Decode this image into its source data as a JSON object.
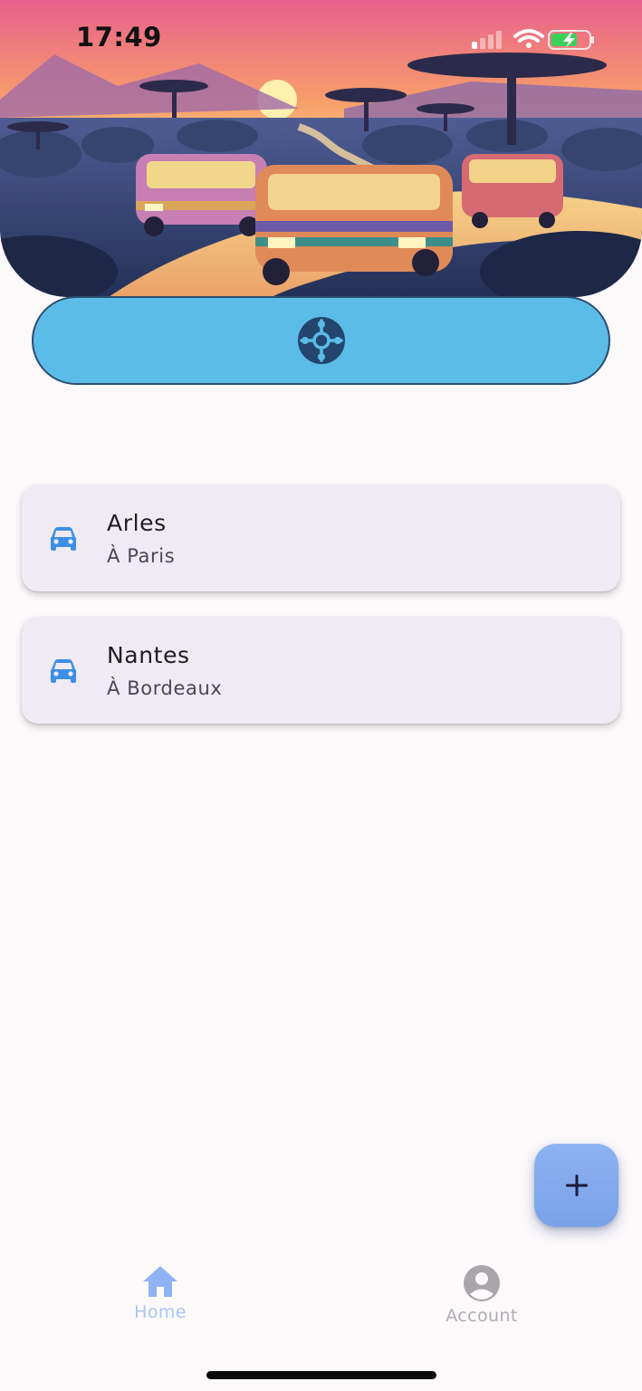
{
  "status_bar": {
    "time": "17:49"
  },
  "hero": {
    "image": "savanna-minibus-illustration"
  },
  "hub_button": {
    "icon": "hub-network-icon",
    "color": "#5bbce8"
  },
  "trips": [
    {
      "title": "Arles",
      "subtitle": "À Paris",
      "icon": "car-icon"
    },
    {
      "title": "Nantes",
      "subtitle": "À Bordeaux",
      "icon": "car-icon"
    }
  ],
  "fab": {
    "label": "+"
  },
  "bottom_nav": {
    "items": [
      {
        "label": "Home",
        "icon": "home-icon",
        "active": true
      },
      {
        "label": "Account",
        "icon": "account-circle-icon",
        "active": false
      }
    ]
  },
  "colors": {
    "accent": "#5bbce8",
    "car_icon": "#3d8fe6",
    "nav_active": "#a9c5f5",
    "nav_inactive": "#b0adb3"
  }
}
